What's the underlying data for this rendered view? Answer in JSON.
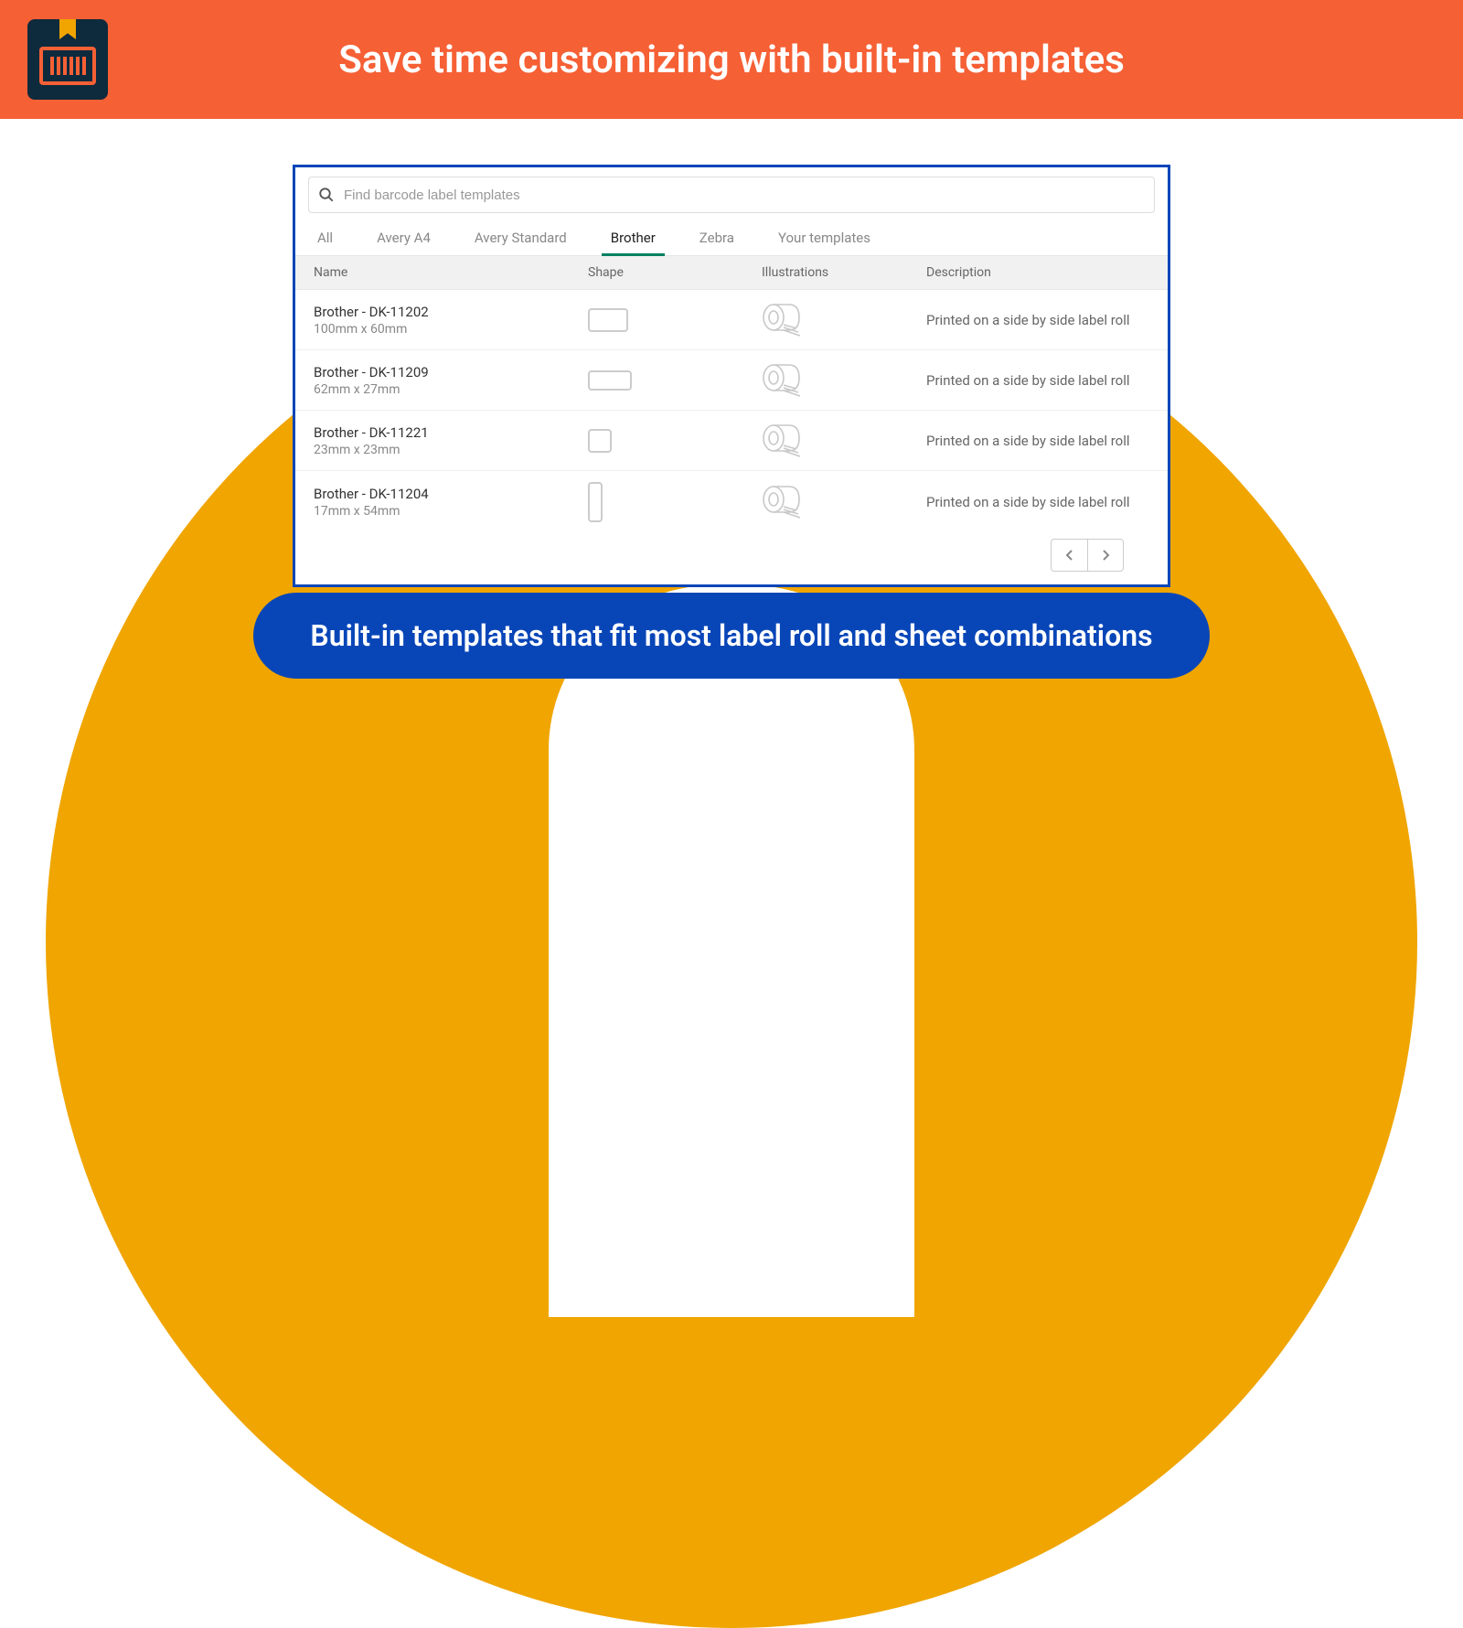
{
  "header": {
    "title": "Save time customizing with built-in templates"
  },
  "search": {
    "placeholder": "Find barcode label templates"
  },
  "tabs": [
    {
      "label": "All",
      "active": false
    },
    {
      "label": "Avery A4",
      "active": false
    },
    {
      "label": "Avery Standard",
      "active": false
    },
    {
      "label": "Brother",
      "active": true
    },
    {
      "label": "Zebra",
      "active": false
    },
    {
      "label": "Your templates",
      "active": false
    }
  ],
  "columns": {
    "name": "Name",
    "shape": "Shape",
    "illustrations": "Illustrations",
    "description": "Description"
  },
  "rows": [
    {
      "name": "Brother - DK-11202",
      "size": "100mm x 60mm",
      "shape": "wide",
      "description": "Printed on a side by side label roll"
    },
    {
      "name": "Brother - DK-11209",
      "size": "62mm x 27mm",
      "shape": "med",
      "description": "Printed on a side by side label roll"
    },
    {
      "name": "Brother - DK-11221",
      "size": "23mm x 23mm",
      "shape": "square",
      "description": "Printed on a side by side label roll"
    },
    {
      "name": "Brother - DK-11204",
      "size": "17mm x 54mm",
      "shape": "tall",
      "description": "Printed on a side by side label roll"
    }
  ],
  "caption": "Built-in templates that fit most label roll and sheet combinations"
}
